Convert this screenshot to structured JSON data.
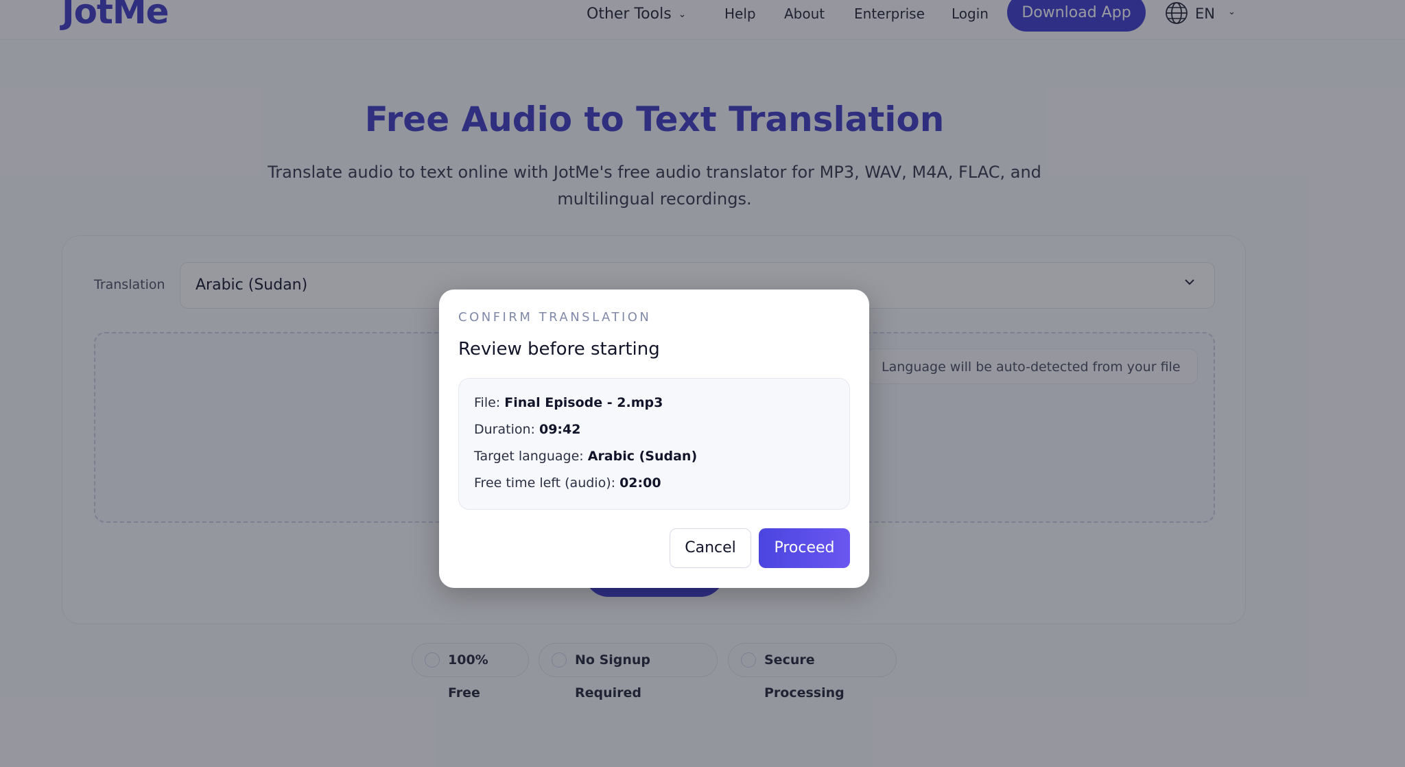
{
  "header": {
    "logo": "JotMe",
    "nav": {
      "other_tools": "Other Tools",
      "help": "Help",
      "about": "About",
      "enterprise": "Enterprise",
      "login": "Login"
    },
    "download_label": "Download App",
    "language_code": "EN"
  },
  "hero": {
    "title": "Free Audio to Text Translation",
    "subtitle_line1": "Translate audio to text online with JotMe's free audio translator for MP3, WAV, M4A, FLAC, and",
    "subtitle_line2": "multilingual recordings."
  },
  "translator": {
    "label": "Translation",
    "selected_language": "Arabic (Sudan)",
    "autodetect_note": "Language will be auto-detected from your file"
  },
  "badges": [
    "100% Free",
    "No Signup Required",
    "Secure Processing"
  ],
  "modal": {
    "eyebrow": "CONFIRM TRANSLATION",
    "title": "Review before starting",
    "file_label": "File:",
    "file_value": "Final Episode - 2.mp3",
    "duration_label": "Duration:",
    "duration_value": "09:42",
    "target_label": "Target language:",
    "target_value": "Arabic (Sudan)",
    "free_time_label": "Free time left (audio):",
    "free_time_value": "02:00",
    "cancel_label": "Cancel",
    "proceed_label": "Proceed"
  },
  "colors": {
    "brand": "#3e3ac4",
    "button": "#3f3bd0",
    "proceed_gradient_start": "#4b45e0",
    "proceed_gradient_end": "#6a57f0"
  }
}
